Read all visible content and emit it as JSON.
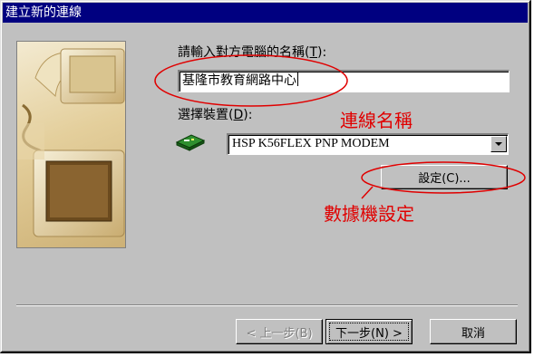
{
  "window": {
    "title": "建立新的連線"
  },
  "connection_name": {
    "label_prefix": "請輸入對方電腦的名稱(",
    "label_hotkey": "T",
    "label_suffix": "):",
    "value": "基隆市教育網路中心"
  },
  "device": {
    "label_prefix": "選擇裝置(",
    "label_hotkey": "D",
    "label_suffix": "):",
    "selected": "HSP K56FLEX PNP MODEM",
    "icon": "modem-icon"
  },
  "settings_button": {
    "label": "設定(C)..."
  },
  "annotations": {
    "connection_name_note": "連線名稱",
    "modem_settings_note": "數據機設定",
    "color": "#e00000"
  },
  "footer": {
    "back_label": "< 上一步(B)",
    "next_label": "下一步(N) >",
    "cancel_label": "取消"
  },
  "colors": {
    "titlebar": "#000080",
    "dialog_face": "#c0c0c0"
  }
}
